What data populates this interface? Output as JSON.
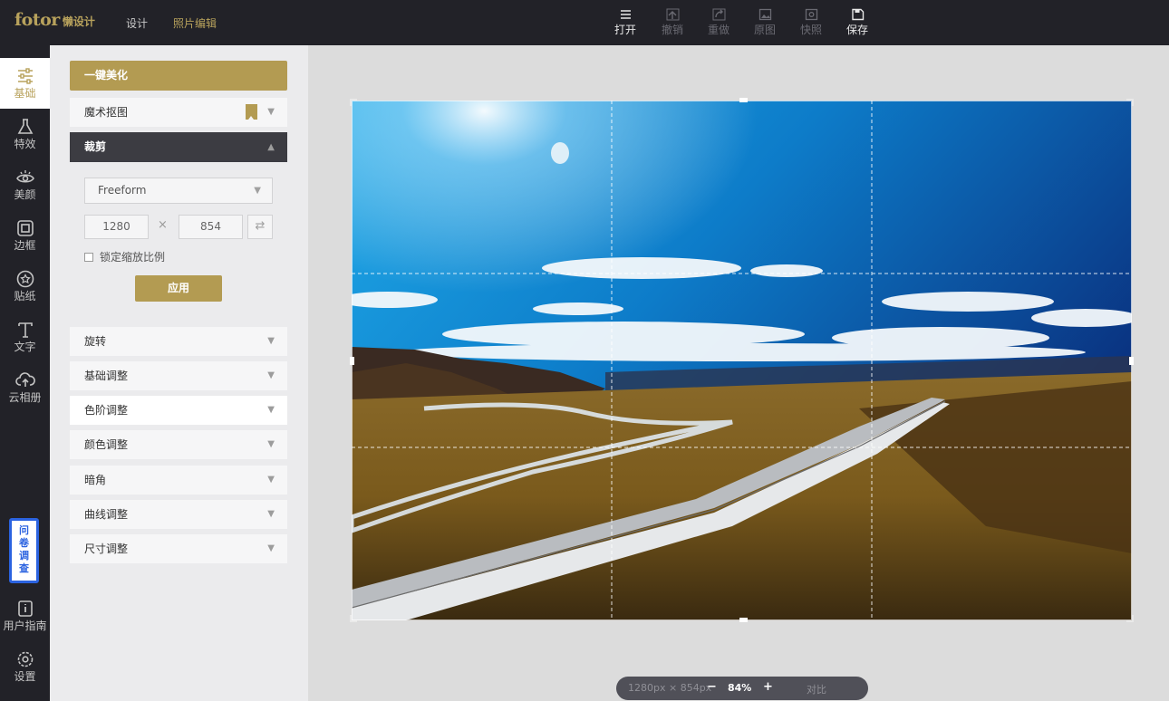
{
  "app": {
    "logo": "fotor",
    "logo_sub": "懒设计",
    "nav": [
      "设计",
      "照片编辑"
    ],
    "active_nav": "照片编辑"
  },
  "toolbar": {
    "open": "打开",
    "undo": "撤销",
    "redo": "重做",
    "original": "原图",
    "snapshot": "快照",
    "save": "保存"
  },
  "rail": {
    "basic": "基础",
    "effects": "特效",
    "beauty": "美颜",
    "frame": "边框",
    "sticker": "贴纸",
    "text": "文字",
    "cloud": "云相册",
    "survey": [
      "问",
      "卷",
      "调",
      "查"
    ],
    "guide": "用户指南",
    "settings": "设置"
  },
  "panel": {
    "one_click": "一键美化",
    "cutout": "魔术抠图",
    "crop": "裁剪",
    "ratio_select": "Freeform",
    "width": "1280",
    "height": "854",
    "times": "×",
    "lock_ratio": "锁定缩放比例",
    "apply": "应用",
    "sections": [
      "旋转",
      "基础调整",
      "色阶调整",
      "颜色调整",
      "暗角",
      "曲线调整",
      "尺寸调整"
    ]
  },
  "canvas": {
    "size_info": "1280px × 854px",
    "zoom_out": "−",
    "zoom": "84%",
    "zoom_in": "+",
    "compare": "对比"
  },
  "colors": {
    "accent": "#b39b52",
    "dark_bg": "#222228",
    "panel_bg": "#ebebed",
    "canvas_bg": "#dcdcdc",
    "survey_blue": "#2b63e0"
  }
}
